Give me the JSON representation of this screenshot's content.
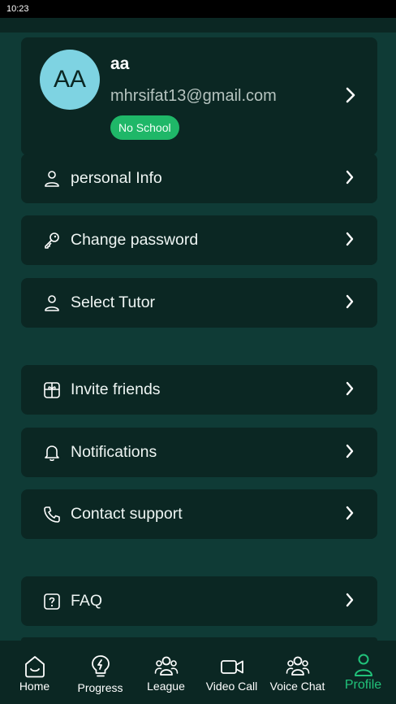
{
  "status": {
    "time": "10:23"
  },
  "profile": {
    "initials": "AA",
    "name": "aa",
    "email": "mhrsifat13@gmail.com",
    "school_badge": "No School"
  },
  "menu": {
    "personal_info": "personal Info",
    "change_password": "Change password",
    "select_tutor": "Select Tutor",
    "invite_friends": "Invite friends",
    "notifications": "Notifications",
    "contact_support": "Contact support",
    "faq": "FAQ"
  },
  "tabs": [
    {
      "label": "Home",
      "icon": "home-icon"
    },
    {
      "label": "Progress",
      "icon": "progress-icon"
    },
    {
      "label": "League",
      "icon": "league-icon"
    },
    {
      "label": "Video Call",
      "icon": "video-call-icon"
    },
    {
      "label": "Voice Chat",
      "icon": "voice-chat-icon"
    },
    {
      "label": "Profile",
      "icon": "profile-icon",
      "active": true
    }
  ],
  "colors": {
    "background": "#0f3b36",
    "card": "#0b2723",
    "accent": "#21c27a",
    "avatar": "#7ed3e2",
    "badge": "#1fb768"
  }
}
